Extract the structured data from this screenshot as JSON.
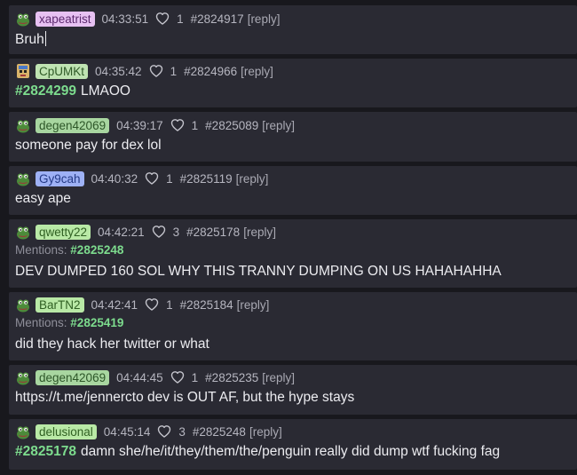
{
  "colors": {
    "page_bg": "#18181d",
    "card_bg": "#2a2a33",
    "link_green": "#7ddc8e",
    "meta_text": "#b6b6c0"
  },
  "posts": [
    {
      "username": "xapeatrist",
      "badge_bg": "#e7c1f2",
      "badge_fg": "#5d2a6f",
      "avatar": "pepe-frog-icon",
      "time": "04:33:51",
      "likes": "1",
      "post_id": "#2824917",
      "reply": "[reply]",
      "quote": "",
      "mentions_label": "",
      "mention": "",
      "text": "Bruh",
      "caret": true
    },
    {
      "username": "CpUMKt",
      "badge_bg": "#bfe3b2",
      "badge_fg": "#2f5a27",
      "avatar": "pixel-character-icon",
      "time": "04:35:42",
      "likes": "1",
      "post_id": "#2824966",
      "reply": "[reply]",
      "quote": "#2824299",
      "mentions_label": "",
      "mention": "",
      "text": "LMAOO"
    },
    {
      "username": "degen42069",
      "badge_bg": "#a8d6a0",
      "badge_fg": "#2d5628",
      "avatar": "pepe-frog-icon",
      "time": "04:39:17",
      "likes": "1",
      "post_id": "#2825089",
      "reply": "[reply]",
      "quote": "",
      "mentions_label": "",
      "mention": "",
      "text": "someone pay for dex lol"
    },
    {
      "username": "Gy9cah",
      "badge_bg": "#9eb1f5",
      "badge_fg": "#243a86",
      "avatar": "pepe-frog-icon",
      "time": "04:40:32",
      "likes": "1",
      "post_id": "#2825119",
      "reply": "[reply]",
      "quote": "",
      "mentions_label": "",
      "mention": "",
      "text": "easy ape"
    },
    {
      "username": "qwetty22",
      "badge_bg": "#b9e9a6",
      "badge_fg": "#2f5f22",
      "avatar": "pepe-frog-icon",
      "time": "04:42:21",
      "likes": "3",
      "post_id": "#2825178",
      "reply": "[reply]",
      "quote": "",
      "mentions_label": "Mentions:",
      "mention": "#2825248",
      "text": "DEV DUMPED 160 SOL WHY THIS TRANNY DUMPING ON US HAHAHAHHA"
    },
    {
      "username": "BarTN2",
      "badge_bg": "#b9e9a6",
      "badge_fg": "#2f5f22",
      "avatar": "pepe-frog-icon",
      "time": "04:42:41",
      "likes": "1",
      "post_id": "#2825184",
      "reply": "[reply]",
      "quote": "",
      "mentions_label": "Mentions:",
      "mention": "#2825419",
      "text": "did they hack her twitter or what"
    },
    {
      "username": "degen42069",
      "badge_bg": "#a8d6a0",
      "badge_fg": "#2d5628",
      "avatar": "pepe-frog-icon",
      "time": "04:44:45",
      "likes": "1",
      "post_id": "#2825235",
      "reply": "[reply]",
      "quote": "",
      "mentions_label": "",
      "mention": "",
      "text": "https://t.me/jennercto dev is OUT AF, but the hype stays"
    },
    {
      "username": "delusional",
      "badge_bg": "#b9e9a6",
      "badge_fg": "#2f5f22",
      "avatar": "pepe-frog-icon",
      "time": "04:45:14",
      "likes": "3",
      "post_id": "#2825248",
      "reply": "[reply]",
      "quote": "#2825178",
      "mentions_label": "",
      "mention": "",
      "text": "damn she/he/it/they/them/the/penguin really did dump wtf fucking fag"
    }
  ]
}
